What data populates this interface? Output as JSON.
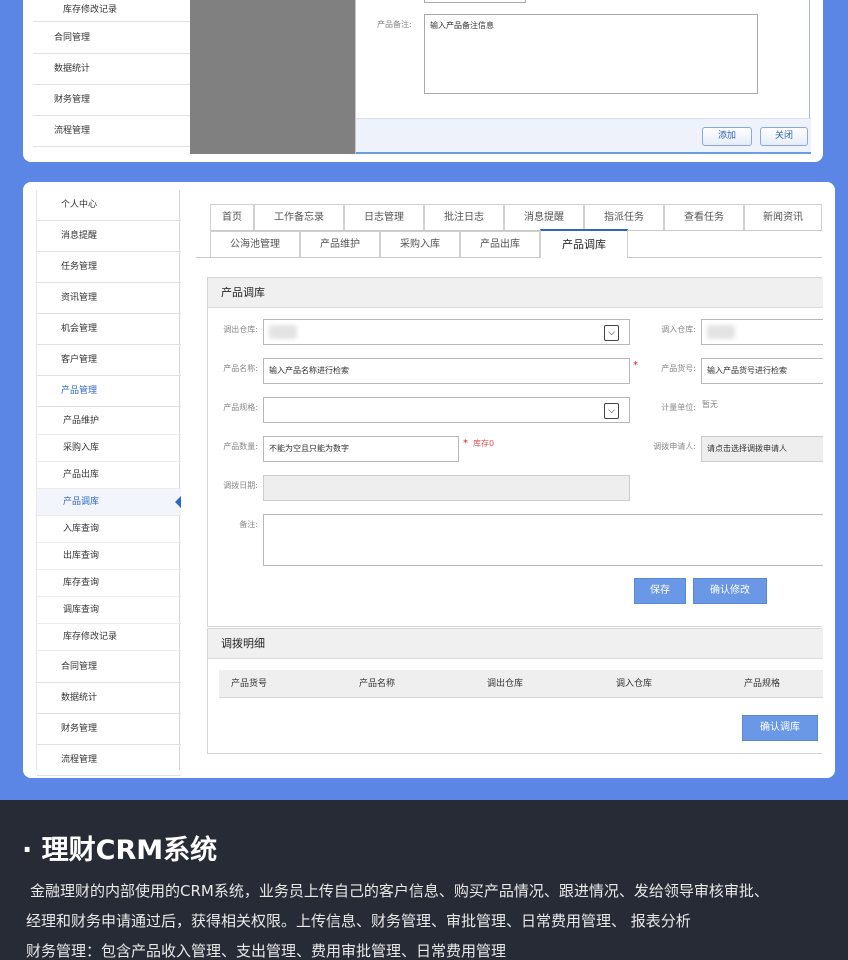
{
  "top_panel": {
    "sidebar_sub_item": "库存修改记录",
    "sidebar_items": [
      "合同管理",
      "数据统计",
      "财务管理",
      "流程管理"
    ],
    "remark_label": "产品备注:",
    "remark_value": "输入产品备注信息",
    "add_button": "添加",
    "close_button": "关闭"
  },
  "sidebar": {
    "items": [
      "个人中心",
      "消息提醒",
      "任务管理",
      "资讯管理",
      "机会管理",
      "客户管理",
      "产品管理"
    ],
    "sub_items": [
      "产品维护",
      "采购入库",
      "产品出库",
      "产品调库",
      "入库查询",
      "出库查询",
      "库存查询",
      "调库查询",
      "库存修改记录"
    ],
    "bottom_items": [
      "合同管理",
      "数据统计",
      "财务管理",
      "流程管理"
    ]
  },
  "tabs": {
    "row1": [
      "首页",
      "工作备忘录",
      "日志管理",
      "批注日志",
      "消息提醒",
      "指派任务",
      "查看任务",
      "新闻资讯"
    ],
    "row2": [
      "公海池管理",
      "产品维护",
      "采购入库",
      "产品出库",
      "产品调库"
    ]
  },
  "form": {
    "title": "产品调库",
    "out_warehouse_label": "调出仓库:",
    "in_warehouse_label": "调入仓库:",
    "product_name_label": "产品名称:",
    "product_name_value": "输入产品名称进行检索",
    "product_code_label": "产品货号:",
    "product_code_value": "输入产品货号进行检索",
    "product_spec_label": "产品规格:",
    "unit_label": "计量单位:",
    "unit_value": "暂无",
    "quantity_label": "产品数量:",
    "quantity_value": "不能为空且只能为数字",
    "stock_note": "库存",
    "stock_value": "0",
    "applicant_label": "调拨申请人:",
    "applicant_value": "请点击选择调拨申请人",
    "date_label": "调拨日期:",
    "note_label": "备注:",
    "save_button": "保存",
    "confirm_modify_button": "确认修改"
  },
  "detail": {
    "title": "调拨明细",
    "columns": [
      "产品货号",
      "产品名称",
      "调出仓库",
      "调入仓库",
      "产品规格"
    ],
    "confirm_button": "确认调库"
  },
  "bottom": {
    "title": "· 理财CRM系统",
    "line1": "金融理财的内部使用的CRM系统，业务员上传自己的客户信息、购买产品情况、跟进情况、发给领导审核审批、",
    "line2": "经理和财务申请通过后，获得相关权限。上传信息、财务管理、审批管理、日常费用管理、 报表分析",
    "line3": "财务管理：包含产品收入管理、支出管理、费用审批管理、日常费用管理"
  },
  "colors": {
    "background": "#5b86e5",
    "accent": "#2e66c4",
    "button": "#6a98e6",
    "dark_band": "#272b36"
  }
}
